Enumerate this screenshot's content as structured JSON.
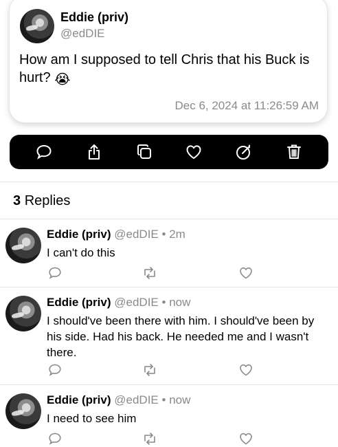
{
  "post": {
    "author_name": "Eddie (priv)",
    "author_handle": "@edDIE",
    "text": "How am I supposed to tell Chris that his Buck is hurt?",
    "emoji": "😭",
    "timestamp": "Dec 6, 2024 at 11:26:59 AM"
  },
  "action_bar": {
    "icons": [
      "speech-bubble-icon",
      "share-icon",
      "copy-icon",
      "heart-icon",
      "edit-icon",
      "trash-icon"
    ]
  },
  "replies_header": {
    "count": "3",
    "label": "Replies"
  },
  "replies": [
    {
      "name": "Eddie (priv)",
      "handle": "@edDIE",
      "sep": "•",
      "time": "2m",
      "text": "I can't do this"
    },
    {
      "name": "Eddie (priv)",
      "handle": "@edDIE",
      "sep": "•",
      "time": "now",
      "text": "I should've been there with him. I should've been by his side. Had his back. He needed me and I wasn't there."
    },
    {
      "name": "Eddie (priv)",
      "handle": "@edDIE",
      "sep": "•",
      "time": "now",
      "text": "I need to see him"
    }
  ],
  "colors": {
    "action_bar_bg": "#000000",
    "secondary_text": "#8a8a8e",
    "divider": "#e3e3e3"
  }
}
